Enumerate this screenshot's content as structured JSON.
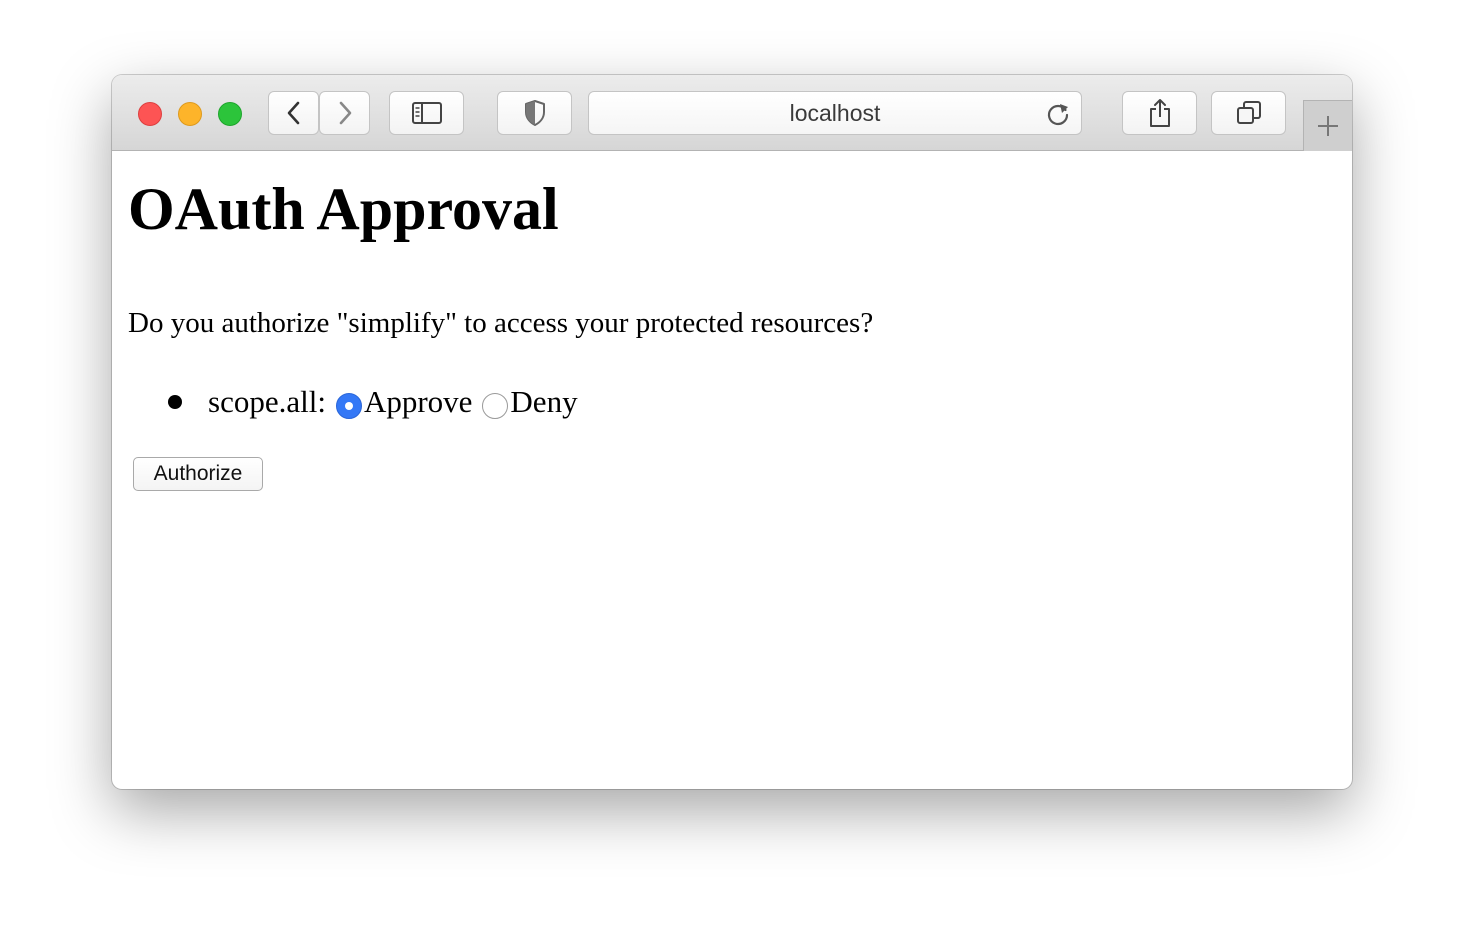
{
  "browser": {
    "address_text": "localhost",
    "icons": [
      "back-icon",
      "forward-icon",
      "sidebar-icon",
      "shield-icon",
      "reload-icon",
      "share-icon",
      "tabs-overview-icon",
      "plus-icon"
    ],
    "traffic_light_colors": {
      "close": "#fd5454",
      "minimize": "#fdb42a",
      "zoom": "#2cc43b"
    }
  },
  "page": {
    "title": "OAuth Approval",
    "question": "Do you authorize \"simplify\" to access your protected resources?",
    "scopes": [
      {
        "label": "scope.all:",
        "options": [
          {
            "label": "Approve",
            "checked": true
          },
          {
            "label": "Deny",
            "checked": false
          }
        ]
      }
    ],
    "submit_label": "Authorize",
    "accent_color": "#3478f6"
  }
}
